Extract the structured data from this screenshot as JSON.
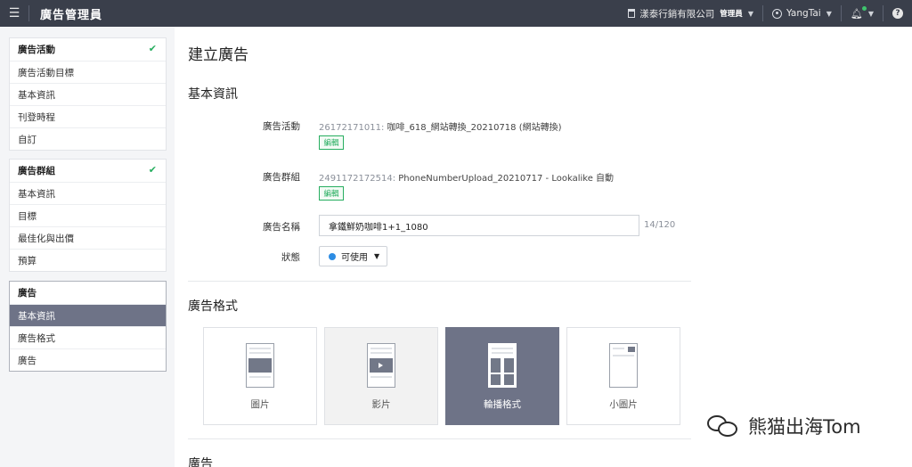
{
  "topbar": {
    "app_title": "廣告管理員",
    "company": "漾泰行銷有限公司",
    "role": "管理員",
    "user": "YangTai"
  },
  "sidebar": {
    "campaign": {
      "items": [
        "廣告活動",
        "廣告活動目標",
        "基本資訊",
        "刊登時程",
        "自訂"
      ]
    },
    "adgroup": {
      "items": [
        "廣告群組",
        "基本資訊",
        "目標",
        "最佳化與出價",
        "預算"
      ]
    },
    "ad": {
      "items": [
        "廣告",
        "基本資訊",
        "廣告格式",
        "廣告"
      ]
    }
  },
  "main": {
    "page_title": "建立廣告",
    "basic_section": "基本資訊",
    "campaign": {
      "label": "廣告活動",
      "id": "26172171011:",
      "name": "咖啡_618_網站轉換_20210718 (網站轉換)",
      "edit": "編輯"
    },
    "adgroup": {
      "label": "廣告群組",
      "id": "2491172172514:",
      "name": "PhoneNumberUpload_20210717 - Lookalike 自動",
      "edit": "編輯"
    },
    "ad_name": {
      "label": "廣告名稱",
      "value": "拿鐵鮮奶咖啡1+1_1080",
      "counter": "14/120"
    },
    "status": {
      "label": "狀態",
      "value": "可使用"
    },
    "format_section": "廣告格式",
    "formats": [
      {
        "label": "圖片",
        "state": "normal"
      },
      {
        "label": "影片",
        "state": "hover"
      },
      {
        "label": "輪播格式",
        "state": "selected"
      },
      {
        "label": "小圖片",
        "state": "normal"
      }
    ],
    "ad_section": "廣告"
  },
  "watermark": "熊猫出海Tom",
  "colors": {
    "topbar": "#3a3f4b",
    "accent_green": "#27ae60",
    "selected": "#6e7387",
    "status_blue": "#2d8ce3"
  }
}
